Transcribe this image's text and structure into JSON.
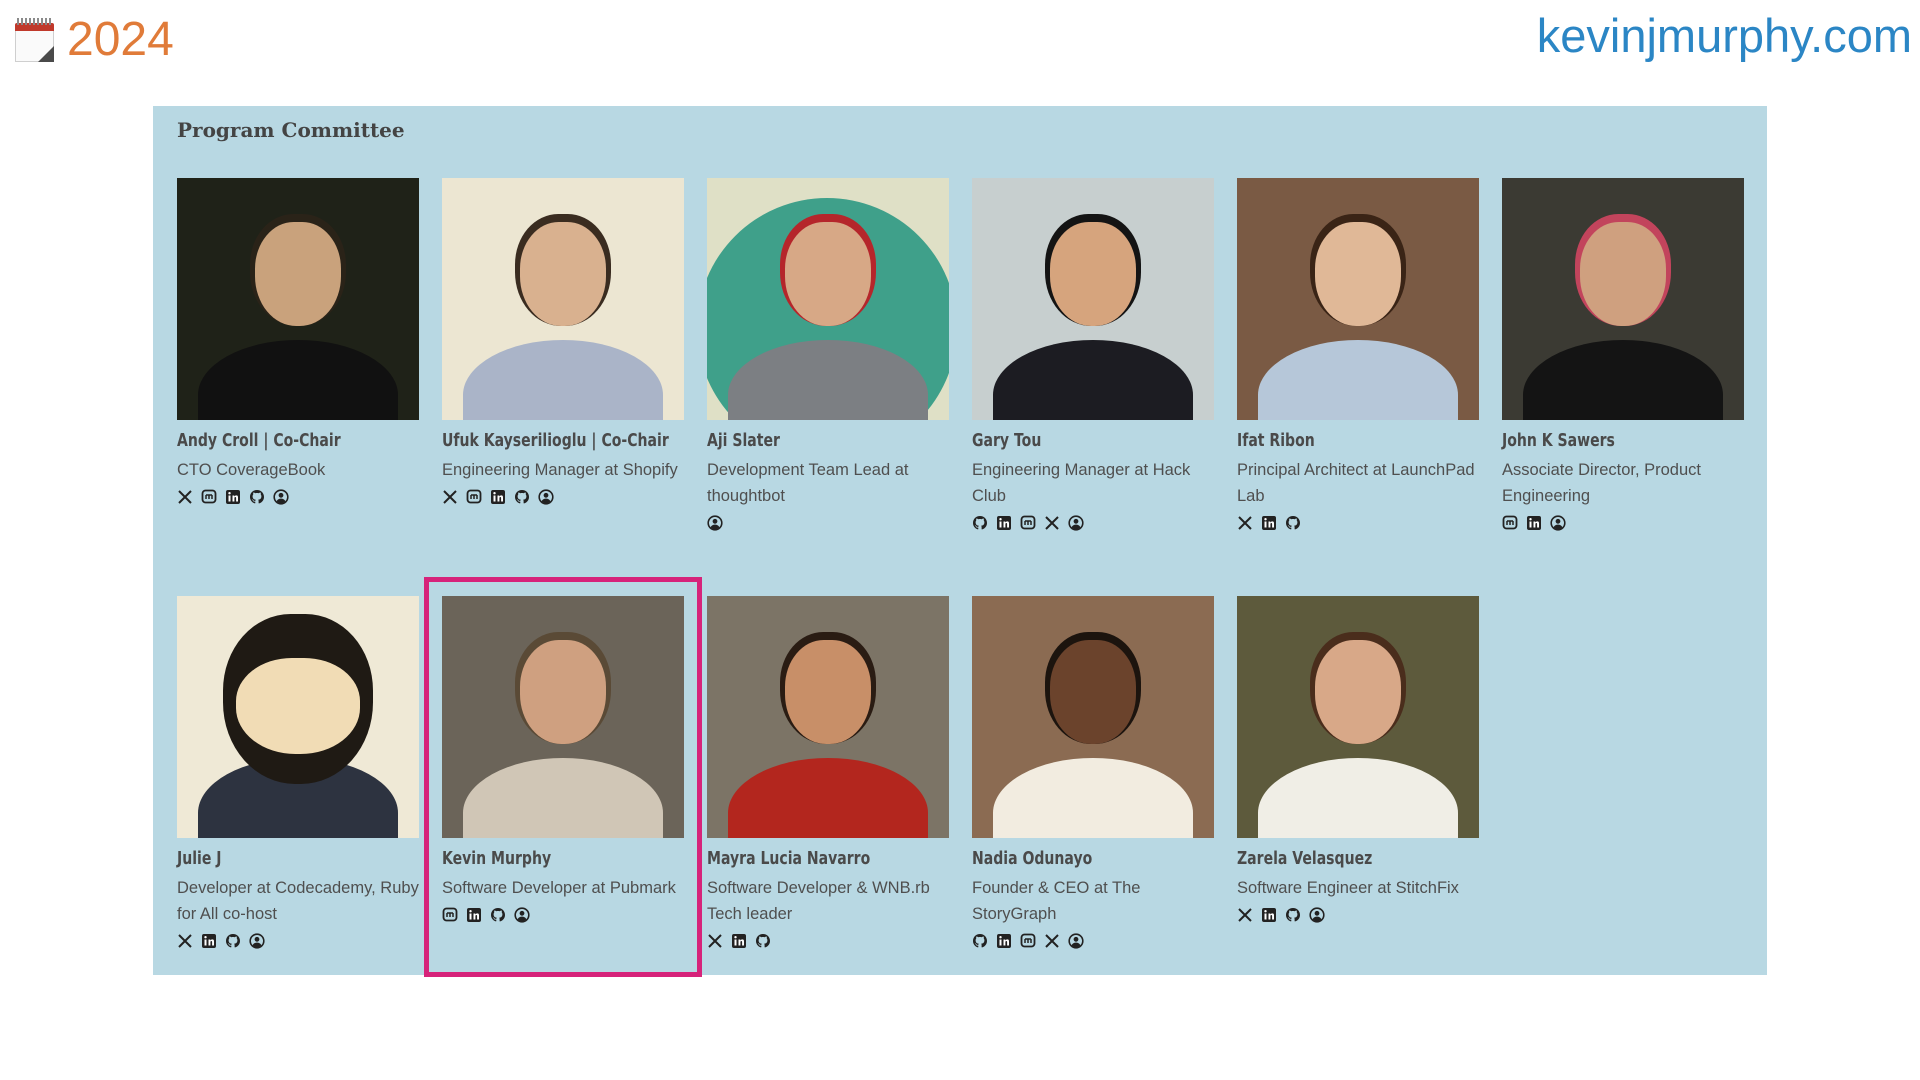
{
  "header": {
    "year": "2024",
    "site": "kevinjmurphy.com",
    "icon": "calendar-icon"
  },
  "panel": {
    "title": "Program Committee"
  },
  "colors": {
    "panel_bg": "#b8d8e3",
    "highlight": "#d6237a",
    "year": "#e07b39",
    "site": "#2b86c5"
  },
  "members": [
    {
      "name": "Andy Croll | Co-Chair",
      "role": "CTO CoverageBook",
      "icons": [
        "x-icon",
        "mastodon-icon",
        "linkedin-icon",
        "github-icon",
        "website-icon"
      ]
    },
    {
      "name": "Ufuk Kayserilioglu | Co-Chair",
      "role": "Engineering Manager at Shopify",
      "icons": [
        "x-icon",
        "mastodon-icon",
        "linkedin-icon",
        "github-icon",
        "website-icon"
      ]
    },
    {
      "name": "Aji Slater",
      "role": "Development Team Lead at thoughtbot",
      "icons": [
        "website-icon"
      ]
    },
    {
      "name": "Gary Tou",
      "role": "Engineering Manager at Hack Club",
      "icons": [
        "github-icon",
        "linkedin-icon",
        "mastodon-icon",
        "x-icon",
        "website-icon"
      ]
    },
    {
      "name": "Ifat Ribon",
      "role": "Principal Architect at LaunchPad Lab",
      "icons": [
        "x-icon",
        "linkedin-icon",
        "github-icon"
      ]
    },
    {
      "name": "John K Sawers",
      "role": "Associate Director, Product Engineering",
      "icons": [
        "mastodon-icon",
        "linkedin-icon",
        "website-icon"
      ]
    },
    {
      "name": "Julie J",
      "role": "Developer at Codecademy, Ruby for All co-host",
      "icons": [
        "x-icon",
        "linkedin-icon",
        "github-icon",
        "website-icon"
      ]
    },
    {
      "name": "Kevin Murphy",
      "role": "Software Developer at Pubmark",
      "icons": [
        "mastodon-icon",
        "linkedin-icon",
        "github-icon",
        "website-icon"
      ]
    },
    {
      "name": "Mayra Lucia Navarro",
      "role": "Software Developer & WNB.rb Tech leader",
      "icons": [
        "x-icon",
        "linkedin-icon",
        "github-icon"
      ]
    },
    {
      "name": "Nadia Odunayo",
      "role": "Founder & CEO at The StoryGraph",
      "icons": [
        "github-icon",
        "linkedin-icon",
        "mastodon-icon",
        "x-icon",
        "website-icon"
      ]
    },
    {
      "name": "Zarela Velasquez",
      "role": "Software Engineer at StitchFix",
      "icons": [
        "x-icon",
        "linkedin-icon",
        "github-icon",
        "website-icon"
      ]
    }
  ]
}
